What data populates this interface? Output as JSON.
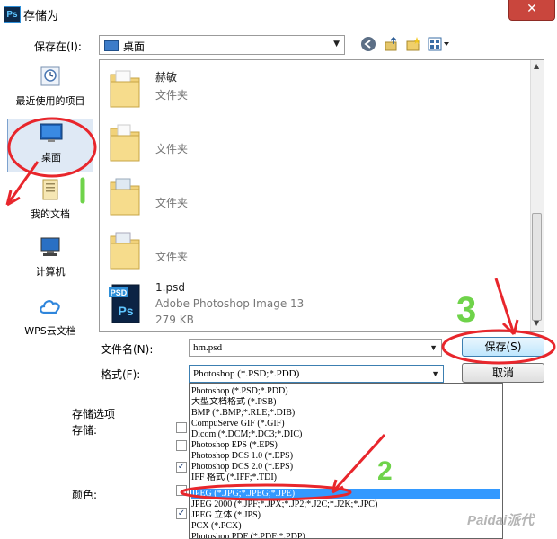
{
  "window": {
    "title": "存储为",
    "app_icon": "Ps"
  },
  "toolbar": {
    "save_in_label": "保存在(I):",
    "location": "桌面"
  },
  "places": [
    {
      "label": "最近使用的项目",
      "icon": "recent-icon"
    },
    {
      "label": "桌面",
      "icon": "desktop-icon"
    },
    {
      "label": "我的文档",
      "icon": "documents-icon"
    },
    {
      "label": "计算机",
      "icon": "computer-icon"
    },
    {
      "label": "WPS云文档",
      "icon": "cloud-icon"
    }
  ],
  "files": [
    {
      "name": "赫敏",
      "type": "文件夹"
    },
    {
      "name": "",
      "type": "文件夹"
    },
    {
      "name": "",
      "type": "文件夹"
    },
    {
      "name": "",
      "type": "文件夹"
    },
    {
      "name": "1.psd",
      "type": "Adobe Photoshop Image 13",
      "size": "279 KB"
    }
  ],
  "form": {
    "filename_label": "文件名(N):",
    "filename_value": "hm.psd",
    "format_label": "格式(F):",
    "format_value": "Photoshop (*.PSD;*.PDD)",
    "save_button": "保存(S)",
    "cancel_button": "取消"
  },
  "options": {
    "section_label": "存储选项",
    "store_label": "存储:",
    "color_label": "颜色:"
  },
  "format_options": [
    "Photoshop (*.PSD;*.PDD)",
    "大型文档格式 (*.PSB)",
    "BMP (*.BMP;*.RLE;*.DIB)",
    "CompuServe GIF (*.GIF)",
    "Dicom (*.DCM;*.DC3;*.DIC)",
    "Photoshop EPS (*.EPS)",
    "Photoshop DCS 1.0 (*.EPS)",
    "Photoshop DCS 2.0 (*.EPS)",
    "IFF 格式 (*.IFF;*.TDI)",
    "JPEG (*.JPG;*.JPEG;*.JPE)",
    "JPEG 2000 (*.JPF;*.JPX;*.JP2;*.J2C;*.J2K;*.JPC)",
    "JPEG 立体 (*.JPS)",
    "PCX (*.PCX)",
    "Photoshop PDF (*.PDF;*.PDP)"
  ],
  "selected_format_index": 9,
  "annotations": {
    "step2": "2",
    "step3": "3"
  },
  "watermark": "Paidai派代",
  "colors": {
    "highlight": "#3399ff",
    "annotation_red": "#e8262c",
    "annotation_green": "#6fd34a"
  }
}
